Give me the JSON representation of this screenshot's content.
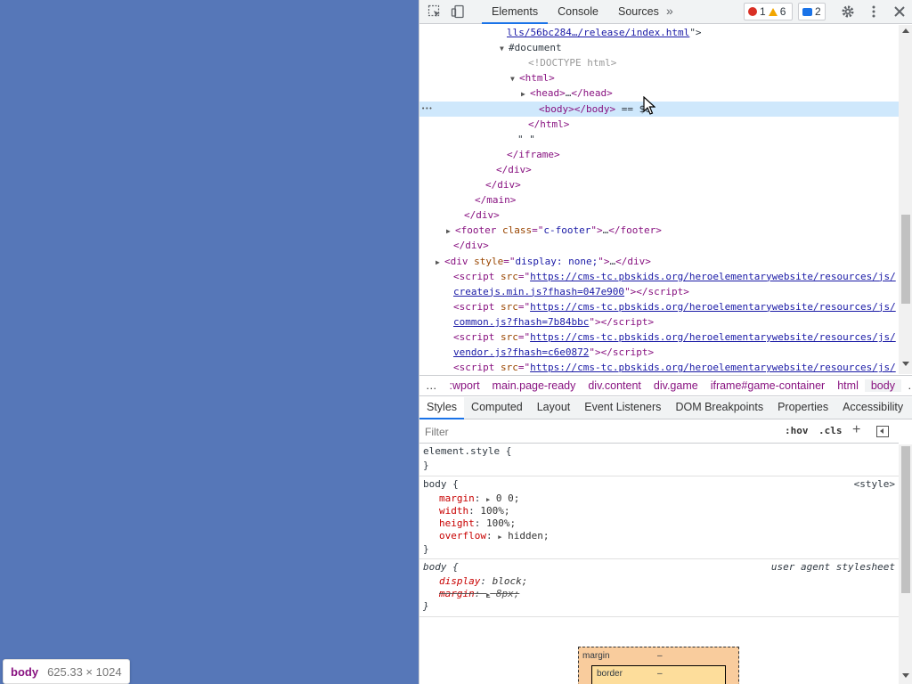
{
  "page": {
    "background": "#5677b8",
    "tooltip": {
      "tag": "body",
      "dims": "625.33 × 1024"
    }
  },
  "toolbar": {
    "tabs": [
      "Elements",
      "Console",
      "Sources"
    ],
    "more": "»",
    "errors": "1",
    "warnings": "6",
    "issues": "2"
  },
  "dom_tree": [
    {
      "indent": 98,
      "html": "<span class=\"link\">lls/56bc284…/release/index.html</span><span class=\"txt\">\"&gt;</span>"
    },
    {
      "indent": 100,
      "tri": "▼",
      "html": "<span class=\"txt\">#document</span>"
    },
    {
      "indent": 122,
      "html": "<span class=\"cmt\">&lt;!DOCTYPE html&gt;</span>"
    },
    {
      "indent": 112,
      "tri": "▼",
      "html": "<span class=\"tagn\">&lt;html&gt;</span>"
    },
    {
      "indent": 124,
      "tri": "▶",
      "html": "<span class=\"tagn\">&lt;head&gt;</span><span class=\"txt\">…</span><span class=\"tagn\">&lt;/head&gt;</span>"
    },
    {
      "indent": 134,
      "sel": true,
      "html": "<span class=\"tagn\">&lt;body&gt;&lt;/body&gt;</span><span class=\"txt\"> == $0</span>"
    },
    {
      "indent": 122,
      "html": "<span class=\"tagn\">&lt;/html&gt;</span>"
    },
    {
      "indent": 110,
      "html": "<span class=\"txt\">\" \"</span>"
    },
    {
      "indent": 98,
      "html": "<span class=\"tagn\">&lt;/iframe&gt;</span>"
    },
    {
      "indent": 86,
      "html": "<span class=\"tagn\">&lt;/div&gt;</span>"
    },
    {
      "indent": 74,
      "html": "<span class=\"tagn\">&lt;/div&gt;</span>"
    },
    {
      "indent": 62,
      "html": "<span class=\"tagn\">&lt;/main&gt;</span>"
    },
    {
      "indent": 50,
      "html": "<span class=\"tagn\">&lt;/div&gt;</span>"
    },
    {
      "indent": 40,
      "tri": "▶",
      "html": "<span class=\"tagn\">&lt;footer </span><span class=\"attn\">class</span><span class=\"tagn\">=\"</span><span class=\"attv\">c-footer</span><span class=\"tagn\">\"&gt;</span><span class=\"txt\">…</span><span class=\"tagn\">&lt;/footer&gt;</span>"
    },
    {
      "indent": 38,
      "html": "<span class=\"tagn\">&lt;/div&gt;</span>"
    },
    {
      "indent": 28,
      "tri": "▶",
      "html": "<span class=\"tagn\">&lt;div </span><span class=\"attn\">style</span><span class=\"tagn\">=\"</span><span class=\"attv\">display: none;</span><span class=\"tagn\">\"&gt;</span><span class=\"txt\">…</span><span class=\"tagn\">&lt;/div&gt;</span>"
    },
    {
      "indent": 38,
      "html": "<span class=\"tagn\">&lt;script </span><span class=\"attn\">src</span><span class=\"tagn\">=\"</span><span class=\"link\">https://cms-tc.pbskids.org/heroelementarywebsite/resources/js/</span>"
    },
    {
      "indent": 38,
      "html": "<span class=\"link\">createjs.min.js?fhash=047e900</span><span class=\"tagn\">\"&gt;&lt;/script&gt;</span>"
    },
    {
      "indent": 38,
      "html": "<span class=\"tagn\">&lt;script </span><span class=\"attn\">src</span><span class=\"tagn\">=\"</span><span class=\"link\">https://cms-tc.pbskids.org/heroelementarywebsite/resources/js/</span>"
    },
    {
      "indent": 38,
      "html": "<span class=\"link\">common.js?fhash=7b84bbc</span><span class=\"tagn\">\"&gt;&lt;/script&gt;</span>"
    },
    {
      "indent": 38,
      "html": "<span class=\"tagn\">&lt;script </span><span class=\"attn\">src</span><span class=\"tagn\">=\"</span><span class=\"link\">https://cms-tc.pbskids.org/heroelementarywebsite/resources/js/</span>"
    },
    {
      "indent": 38,
      "html": "<span class=\"link\">vendor.js?fhash=c6e0872</span><span class=\"tagn\">\"&gt;&lt;/script&gt;</span>"
    },
    {
      "indent": 38,
      "html": "<span class=\"tagn\">&lt;script </span><span class=\"attn\">src</span><span class=\"tagn\">=\"</span><span class=\"link\">https://cms-tc.pbskids.org/heroelementarywebsite/resources/js/</span>"
    }
  ],
  "breadcrumb": {
    "ellipsis_left": "…",
    "items": [
      ":wport",
      "main.page-ready",
      "div.content",
      "div.game",
      "iframe#game-container",
      "html",
      "body"
    ],
    "ellipsis_right": "…"
  },
  "pane_tabs": [
    "Styles",
    "Computed",
    "Layout",
    "Event Listeners",
    "DOM Breakpoints",
    "Properties",
    "Accessibility"
  ],
  "filter": {
    "placeholder": "Filter",
    "hov": ":hov",
    "cls": ".cls",
    "plus": "+"
  },
  "styles": {
    "element_style": {
      "selector": "element.style {",
      "close": "}"
    },
    "body_rule": {
      "selector": "body {",
      "origin": "<style>",
      "props": [
        {
          "name": "margin",
          "expander": "▶",
          "value": "0 0;"
        },
        {
          "name": "width",
          "value": "100%;"
        },
        {
          "name": "height",
          "value": "100%;"
        },
        {
          "name": "overflow",
          "expander": "▶",
          "value": "hidden;"
        }
      ],
      "close": "}"
    },
    "ua_rule": {
      "selector": "body {",
      "origin": "user agent stylesheet",
      "props": [
        {
          "name": "display",
          "value": "block;"
        },
        {
          "name": "margin",
          "expander": "▶",
          "value": "8px;"
        }
      ],
      "close": "}"
    }
  },
  "box_model": {
    "margin_label": "margin",
    "margin_value": "–",
    "border_label": "border",
    "border_value": "–"
  }
}
